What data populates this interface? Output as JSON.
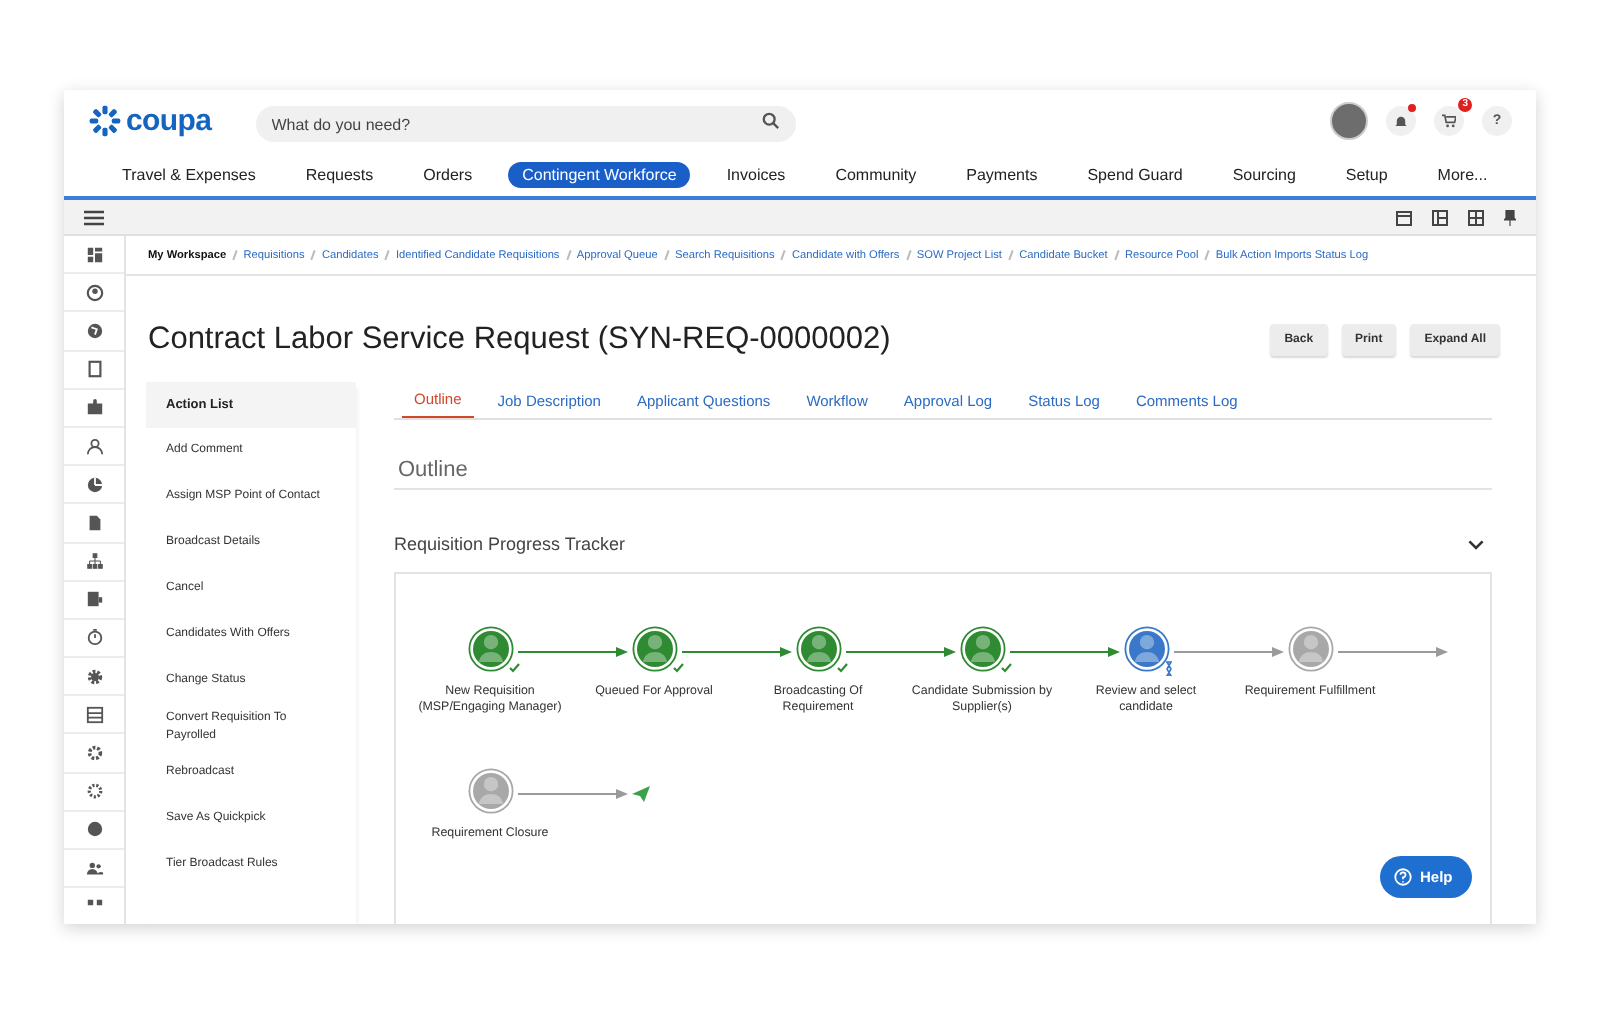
{
  "header": {
    "logo": "coupa",
    "search": {
      "placeholder": "What do you need?"
    },
    "has_notifications": true,
    "cart_badge": "3",
    "help": "?"
  },
  "nav": {
    "items": [
      {
        "label": "Travel & Expenses",
        "selected": false
      },
      {
        "label": "Requests",
        "selected": false
      },
      {
        "label": "Orders",
        "selected": false
      },
      {
        "label": "Contingent Workforce",
        "selected": true
      },
      {
        "label": "Invoices",
        "selected": false
      },
      {
        "label": "Community",
        "selected": false
      },
      {
        "label": "Payments",
        "selected": false
      },
      {
        "label": "Spend Guard",
        "selected": false
      },
      {
        "label": "Sourcing",
        "selected": false
      },
      {
        "label": "Setup",
        "selected": false
      },
      {
        "label": "More...",
        "selected": false
      }
    ]
  },
  "breadcrumbs": [
    {
      "label": "My Workspace",
      "selected": true
    },
    {
      "label": "Requisitions",
      "selected": false
    },
    {
      "label": "Candidates",
      "selected": false
    },
    {
      "label": "Identified Candidate Requisitions",
      "selected": false
    },
    {
      "label": "Approval Queue",
      "selected": false
    },
    {
      "label": "Search Requisitions",
      "selected": false
    },
    {
      "label": "Candidate with Offers",
      "selected": false
    },
    {
      "label": "SOW Project List",
      "selected": false
    },
    {
      "label": "Candidate Bucket",
      "selected": false
    },
    {
      "label": "Resource Pool",
      "selected": false
    },
    {
      "label": "Bulk Action Imports Status Log",
      "selected": false
    }
  ],
  "page": {
    "title": "Contract Labor Service Request (SYN-REQ-0000002)",
    "buttons": [
      "Back",
      "Print",
      "Expand All"
    ]
  },
  "action_list": {
    "title": "Action List",
    "items": [
      "Add Comment",
      "Assign MSP Point of Contact",
      "Broadcast Details",
      "Cancel",
      "Candidates With Offers",
      "Change Status",
      "Convert Requisition To\nPayrolled",
      "Rebroadcast",
      "Save As Quickpick",
      "Tier Broadcast Rules"
    ]
  },
  "tabs": [
    {
      "label": "Outline",
      "selected": true
    },
    {
      "label": "Job Description",
      "selected": false
    },
    {
      "label": "Applicant Questions",
      "selected": false
    },
    {
      "label": "Workflow",
      "selected": false
    },
    {
      "label": "Approval Log",
      "selected": false
    },
    {
      "label": "Status Log",
      "selected": false
    },
    {
      "label": "Comments Log",
      "selected": false
    }
  ],
  "section_title": "Outline",
  "tracker": {
    "title": "Requisition Progress Tracker",
    "rows": [
      [
        {
          "label": "New Requisition (MSP/Engaging Manager)",
          "completed": true,
          "current": false
        },
        {
          "label": "Queued For Approval",
          "completed": true,
          "current": false
        },
        {
          "label": "Broadcasting Of Requirement",
          "completed": true,
          "current": false
        },
        {
          "label": "Candidate Submission by Supplier(s)",
          "completed": true,
          "current": false
        },
        {
          "label": "Review and select candidate",
          "completed": false,
          "current": true
        },
        {
          "label": "Requirement Fulfillment",
          "completed": false,
          "current": false
        }
      ],
      [
        {
          "label": "Requirement Closure",
          "completed": false,
          "current": false
        }
      ]
    ]
  },
  "help_button": "Help"
}
